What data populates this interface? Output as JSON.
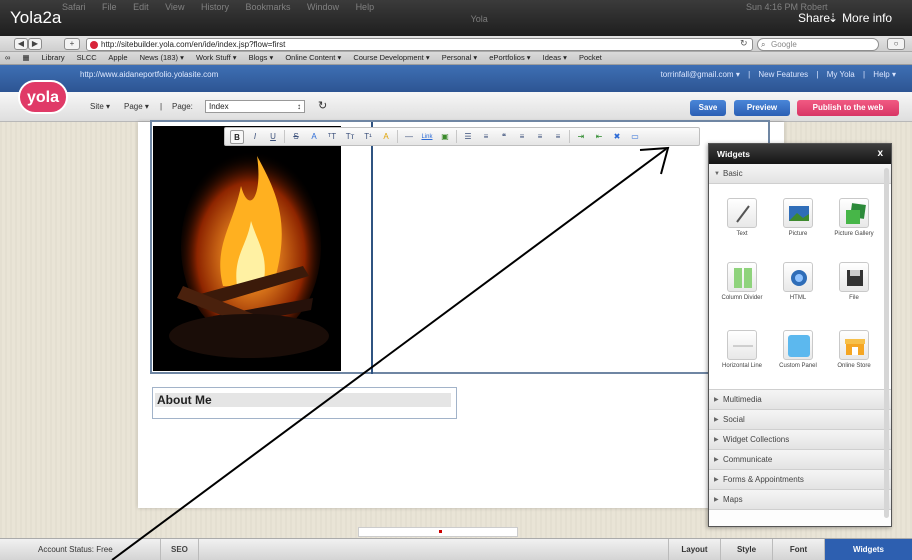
{
  "overlay": {
    "title": "Yola2a",
    "share_label": "Share",
    "more_info_label": "More info",
    "mac_menus": [
      "Safari",
      "File",
      "Edit",
      "View",
      "History",
      "Bookmarks",
      "Window",
      "Help"
    ],
    "window_title": "Yola",
    "clock": "Sun 4:16 PM",
    "user": "Robert"
  },
  "browser": {
    "url": "http://sitebuilder.yola.com/en/ide/index.jsp?flow=first",
    "search_placeholder": "Google",
    "bookmarks": [
      "Library",
      "SLCC",
      "Apple",
      "News (183) ▾",
      "Work Stuff ▾",
      "Blogs ▾",
      "Online Content ▾",
      "Course Development ▾",
      "Personal ▾",
      "ePortfolios ▾",
      "Ideas ▾",
      "Pocket"
    ]
  },
  "yola": {
    "logo_text": "yola",
    "site_url": "http://www.aidaneportfolio.yolasite.com",
    "account_email": "torrinfall@gmail.com ▾",
    "new_features": "New Features",
    "my_yola": "My Yola",
    "help": "Help ▾",
    "site_menu": "Site ▾",
    "page_menu": "Page ▾",
    "page_label": "Page:",
    "page_value": "Index",
    "save_label": "Save",
    "preview_label": "Preview",
    "publish_label": "Publish to the web"
  },
  "content": {
    "about_title": "About Me"
  },
  "widgets": {
    "panel_title": "Widgets",
    "close": "x",
    "basic_label": "Basic",
    "items": [
      {
        "label": "Text",
        "icon": "text-widget-icon"
      },
      {
        "label": "Picture",
        "icon": "picture-widget-icon"
      },
      {
        "label": "Picture Gallery",
        "icon": "picture-gallery-widget-icon"
      },
      {
        "label": "Column Divider",
        "icon": "column-divider-widget-icon"
      },
      {
        "label": "HTML",
        "icon": "html-widget-icon"
      },
      {
        "label": "File",
        "icon": "file-widget-icon"
      },
      {
        "label": "Horizontal Line",
        "icon": "horizontal-line-widget-icon"
      },
      {
        "label": "Custom Panel",
        "icon": "custom-panel-widget-icon"
      },
      {
        "label": "Online Store",
        "icon": "online-store-widget-icon"
      }
    ],
    "sections": [
      "Multimedia",
      "Social",
      "Widget Collections",
      "Communicate",
      "Forms & Appointments",
      "Maps"
    ]
  },
  "footer": {
    "account_status": "Account Status: Free",
    "seo": "SEO",
    "layout": "Layout",
    "style": "Style",
    "font": "Font",
    "widgets": "Widgets"
  },
  "colors": {
    "yola_blue": "#2d5593",
    "publish_pink": "#d83565",
    "arrow": "#000000"
  }
}
